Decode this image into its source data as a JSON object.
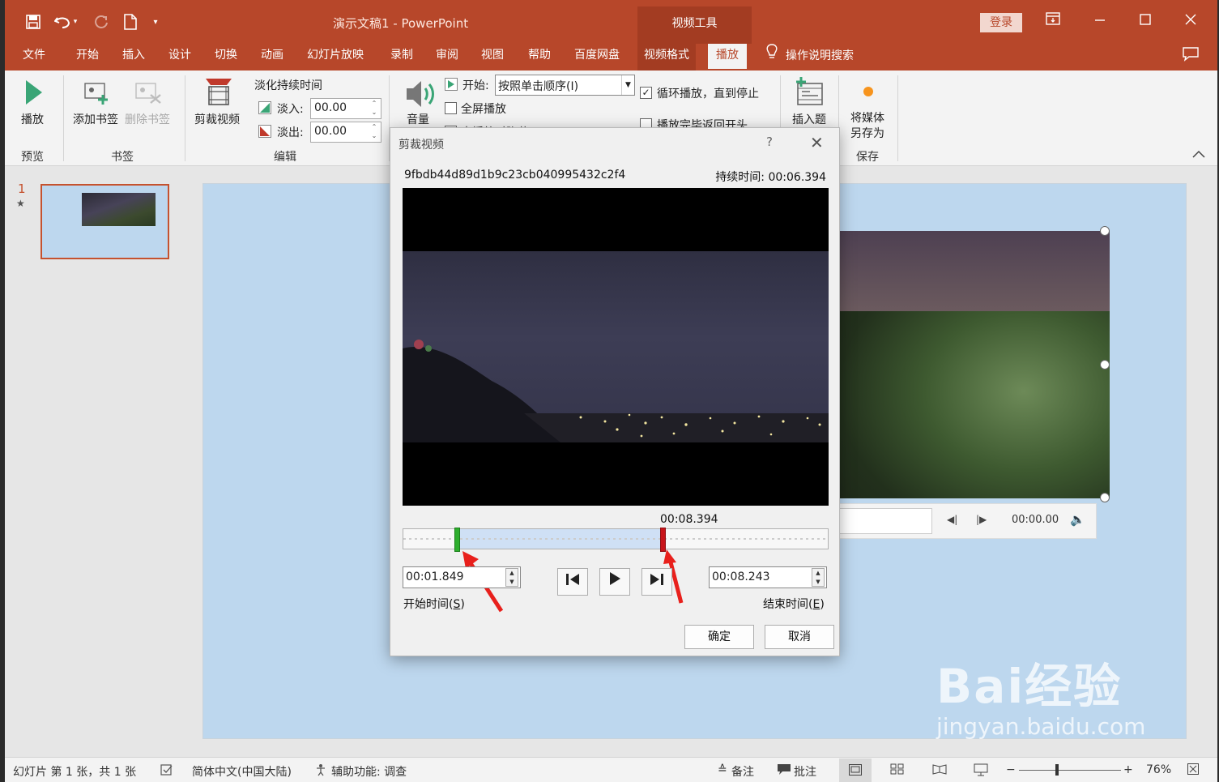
{
  "window": {
    "title": "演示文稿1  -  PowerPoint",
    "context_tool": "视频工具",
    "login": "登录"
  },
  "tabs": [
    "文件",
    "开始",
    "插入",
    "设计",
    "切换",
    "动画",
    "幻灯片放映",
    "录制",
    "审阅",
    "视图",
    "帮助",
    "百度网盘",
    "视频格式",
    "播放"
  ],
  "tell_me": "操作说明搜索",
  "ribbon": {
    "preview": {
      "play": "播放",
      "group": "预览"
    },
    "bookmarks": {
      "add": "添加书签",
      "remove": "删除书签",
      "group": "书签"
    },
    "editing": {
      "trim": "剪裁视频",
      "fade_duration": "淡化持续时间",
      "fade_in_label": "淡入:",
      "fade_in_value": "00.00",
      "fade_out_label": "淡出:",
      "fade_out_value": "00.00",
      "group": "编辑"
    },
    "video_options": {
      "volume": "音量",
      "start_label": "开始:",
      "start_value": "按照单击顺序(I)",
      "fullscreen": "全屏播放",
      "hide_partial": "未播放时隐藏",
      "loop": "循环播放，直到停止",
      "rewind": "播放完毕返回开头"
    },
    "captions": {
      "insert": "插入题"
    },
    "save": {
      "save_media": "将媒体\n另存为",
      "save_media_l1": "将媒体",
      "save_media_l2": "另存为",
      "group": "保存"
    }
  },
  "slides": {
    "number": "1",
    "star": "★"
  },
  "video_controls": {
    "time": "00:00.00"
  },
  "dialog": {
    "title": "剪裁视频",
    "help": "?",
    "close": "✕",
    "filename": "9fbdb44d89d1b9c23cb040995432c2f4",
    "duration": "持续时间: 00:06.394",
    "playhead": "00:08.394",
    "start_time": "00:01.849",
    "end_time": "00:08.243",
    "start_label": "开始时间(",
    "start_key": "S",
    "end_label": "结束时间(",
    "end_key": "E",
    "ok": "确定",
    "cancel": "取消"
  },
  "status": {
    "slide_info": "幻灯片 第 1 张，共 1 张",
    "language": "简体中文(中国大陆)",
    "accessibility": "辅助功能: 调查",
    "notes": "备注",
    "comments": "批注",
    "zoom": "76%"
  },
  "watermark": {
    "brand": "Bai经验",
    "url": "jingyan.baidu.com"
  },
  "colors": {
    "accent": "#b7472a",
    "slide_bg": "#bdd7ee",
    "start_marker": "#2eae2e",
    "end_marker": "#c8141a"
  }
}
